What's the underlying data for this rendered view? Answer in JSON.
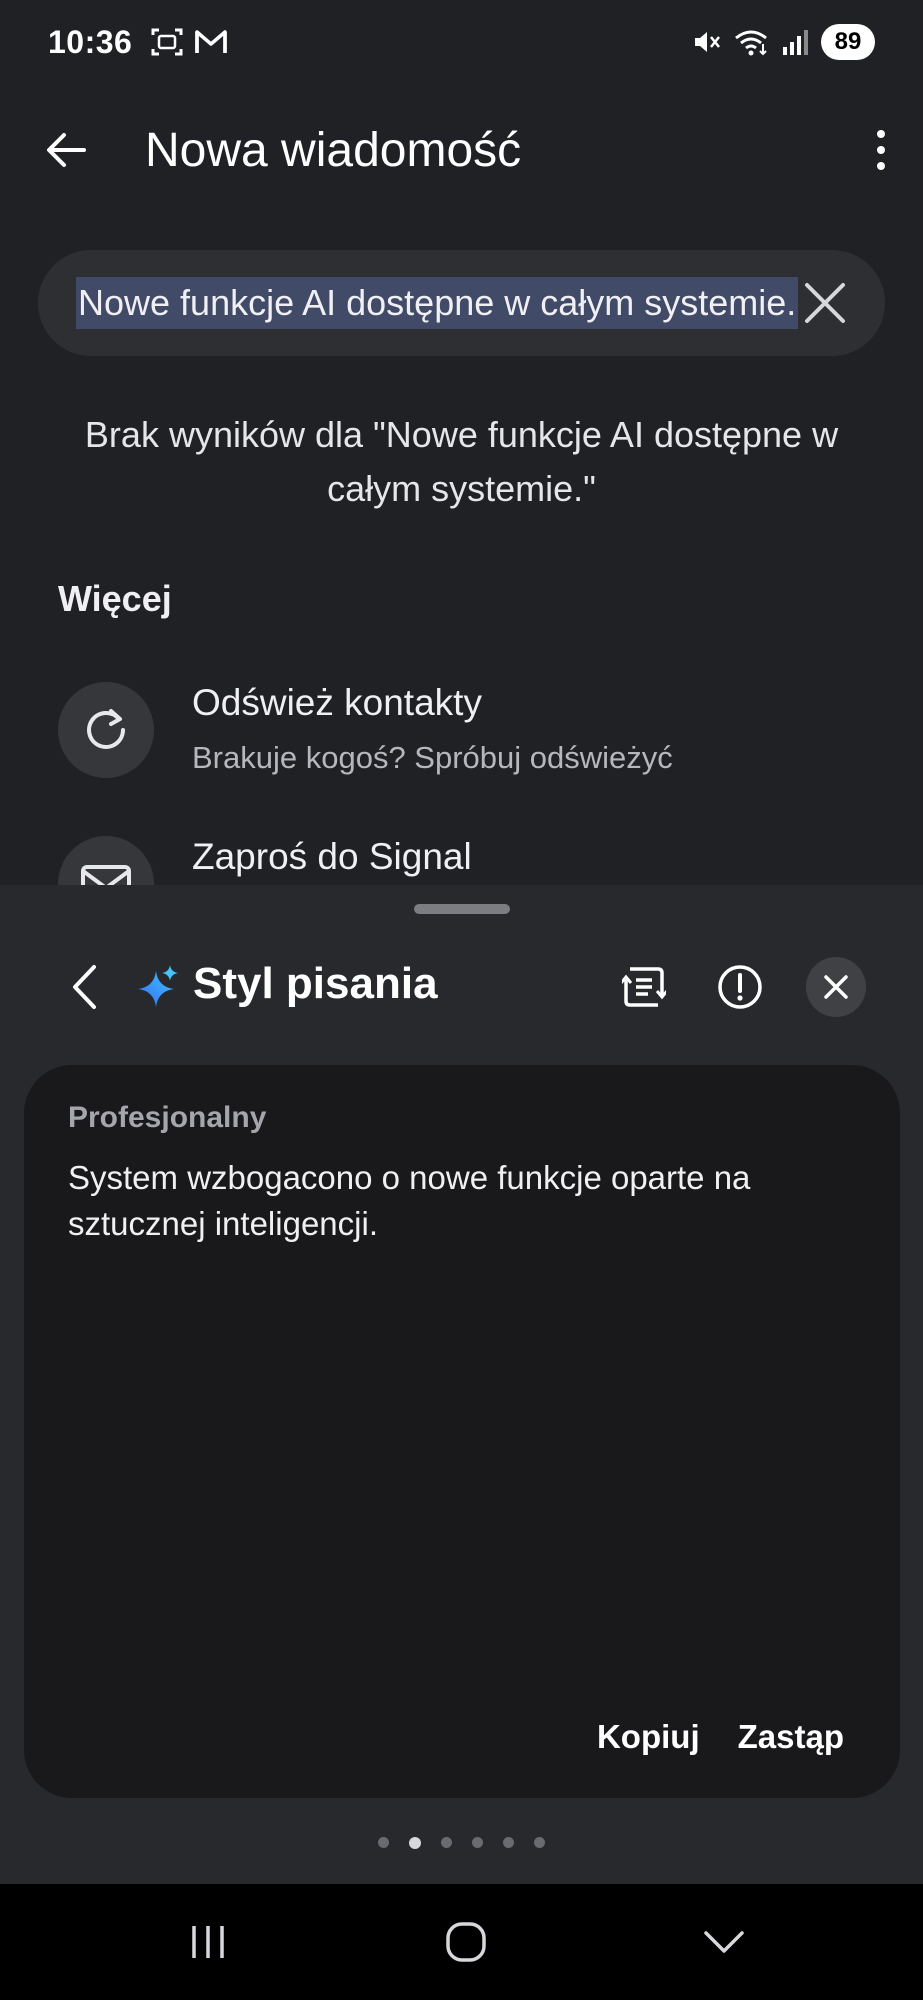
{
  "status_bar": {
    "time": "10:36",
    "battery": "89",
    "left_icons": [
      "screenshot-icon",
      "gmail-icon"
    ],
    "right_icons": [
      "mute-icon",
      "wifi-icon",
      "signal-icon"
    ]
  },
  "header": {
    "title": "Nowa wiadomość",
    "back_icon": "arrow-left-icon",
    "menu_icon": "more-vertical-icon"
  },
  "search": {
    "value": "Nowe funkcje AI dostępne w całym systemie.",
    "clear_icon": "close-icon"
  },
  "no_results": "Brak wyników dla \"Nowe funkcje AI dostępne w całym systemie.\"",
  "more_section": {
    "label": "Więcej",
    "items": [
      {
        "title": "Odśwież kontakty",
        "subtitle": "Brakuje kogoś? Spróbuj odświeżyć",
        "icon": "refresh-icon"
      },
      {
        "title": "Zaproś do Signal",
        "icon": "mail-icon"
      }
    ]
  },
  "writing_panel": {
    "title": "Styl pisania",
    "card": {
      "label": "Profesjonalny",
      "text": "System wzbogacono o nowe funkcje oparte na sztucznej inteligencji."
    },
    "actions": {
      "copy": "Kopiuj",
      "replace": "Zastąp"
    },
    "pages": {
      "count": 6,
      "active_index": 1
    },
    "accent_colors": [
      "#2f6df6",
      "#45c3ff"
    ]
  },
  "nav_bar": [
    "recents-icon",
    "home-icon",
    "back-chevron-icon"
  ]
}
